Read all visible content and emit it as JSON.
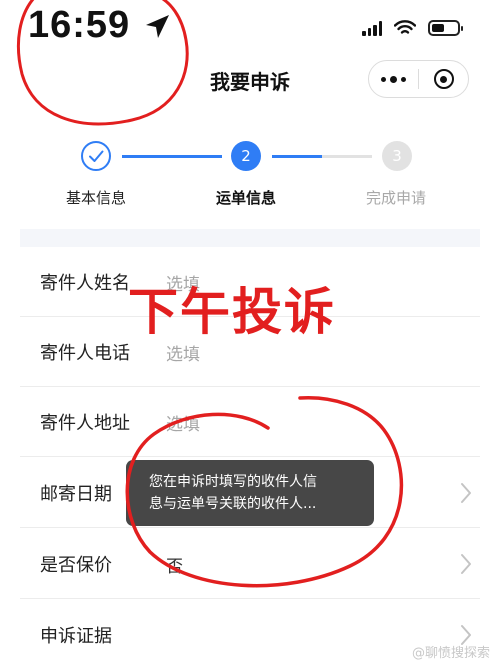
{
  "status_bar": {
    "time": "16:59"
  },
  "nav": {
    "title": "我要申诉"
  },
  "steps": [
    {
      "number": "1",
      "label": "基本信息",
      "state": "done"
    },
    {
      "number": "2",
      "label": "运单信息",
      "state": "active"
    },
    {
      "number": "3",
      "label": "完成申请",
      "state": "pending"
    }
  ],
  "form_rows": [
    {
      "label": "寄件人姓名",
      "value": "选填"
    },
    {
      "label": "寄件人电话",
      "value": "选填"
    },
    {
      "label": "寄件人地址",
      "value": "选填"
    },
    {
      "label": "邮寄日期",
      "value": ""
    },
    {
      "label": "是否保价",
      "value": "否"
    },
    {
      "label": "申诉证据",
      "value": ""
    }
  ],
  "toast": {
    "line1": "您在申诉时填写的收件人信",
    "line2": "息与运单号关联的收件人..."
  },
  "overlay_text": "下午投诉",
  "credit": "@聊愤搜探索",
  "colors": {
    "accent": "#2f7df5",
    "annotation_red": "#e21f1f",
    "placeholder": "#a6a6a6"
  }
}
